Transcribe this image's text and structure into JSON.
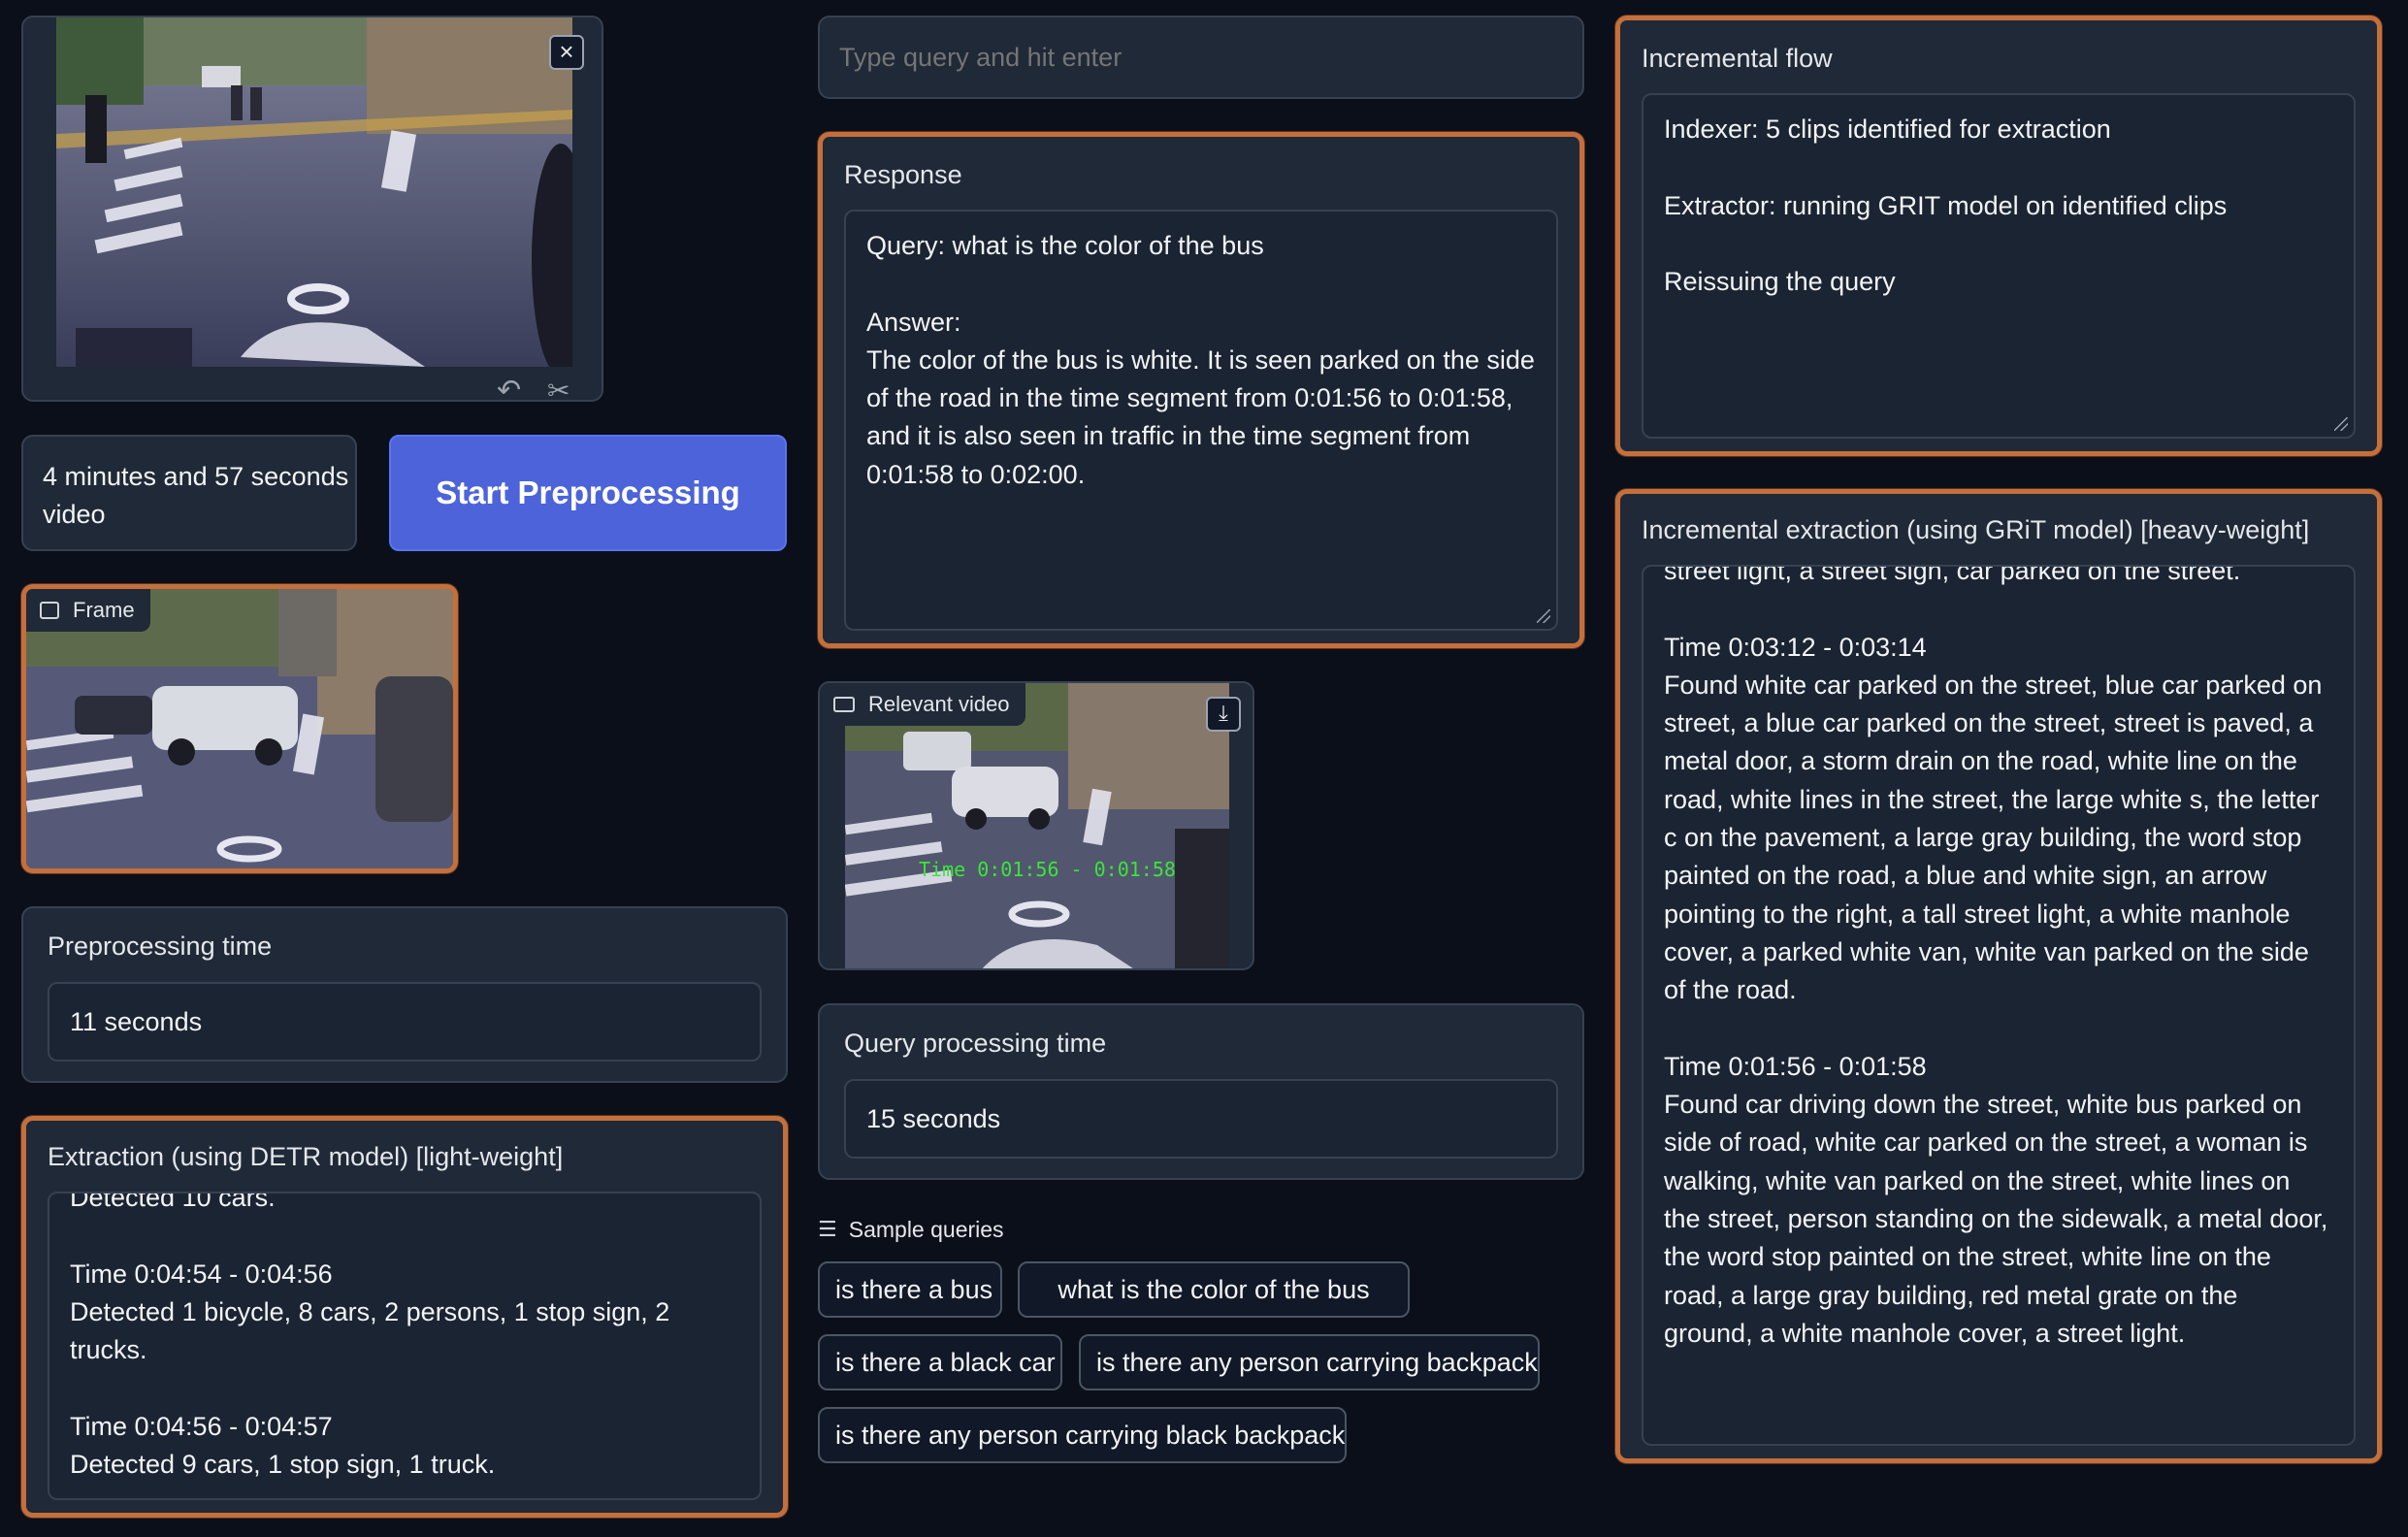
{
  "video_player": {
    "close_icon": "close-icon",
    "undo_icon": "undo-icon",
    "cut_icon": "scissors-icon"
  },
  "video_info": {
    "duration_text": "4 minutes and 57 seconds video"
  },
  "start_button": {
    "label": "Start Preprocessing",
    "color": "#4c63d9"
  },
  "frame": {
    "label": "Frame",
    "icon": "image-icon"
  },
  "preprocessing_time": {
    "label": "Preprocessing time",
    "value": "11 seconds"
  },
  "extraction": {
    "label": "Extraction (using DETR model) [light-weight]",
    "text": "Detected 10 cars.\n\nTime 0:04:54 - 0:04:56\nDetected 1 bicycle, 8 cars, 2 persons, 1 stop sign, 2 trucks.\n\nTime 0:04:56 - 0:04:57\nDetected 9 cars, 1 stop sign, 1 truck."
  },
  "query": {
    "placeholder": "Type query and hit enter"
  },
  "response": {
    "label": "Response",
    "text": "Query: what is the color of the bus\n\nAnswer:\nThe color of the bus is white. It is seen parked on the side of the road in the time segment from 0:01:56 to 0:01:58, and it is also seen in traffic in the time segment from 0:01:58 to 0:02:00."
  },
  "relevant_video": {
    "label": "Relevant video",
    "icon": "video-camera-icon",
    "download_icon": "download-icon",
    "overlay_text": "Time 0:01:56 - 0:01:58"
  },
  "query_processing_time": {
    "label": "Query processing time",
    "value": "15 seconds"
  },
  "sample_queries": {
    "label": "Sample queries",
    "icon": "list-icon",
    "items": [
      "is there a bus",
      "what is the color of the bus",
      "is there a black car",
      "is there any person carrying backpack",
      "is there any person carrying black backpack"
    ]
  },
  "incremental_flow": {
    "label": "Incremental flow",
    "text": "Indexer: 5 clips identified for extraction\n\nExtractor: running GRIT model on identified clips\n\nReissuing the query"
  },
  "incremental_extraction": {
    "label": "Incremental extraction (using GRiT model) [heavy-weight]",
    "text": "street light, a street sign, car parked on the street.\n\nTime 0:03:12 - 0:03:14\nFound white car parked on the street, blue car parked on street, a blue car parked on the street, street is paved, a metal door, a storm drain on the road, white line on the road, white lines in the street, the large white s, the letter c on the pavement, a large gray building, the word stop painted on the road, a blue and white sign, an arrow pointing to the right, a tall street light, a white manhole cover, a parked white van, white van parked on the side of the road.\n\nTime 0:01:56 - 0:01:58\nFound car driving down the street, white bus parked on side of road, white car parked on the street, a woman is walking, white van parked on the street, white lines on the street, person standing on the sidewalk, a metal door, the word stop painted on the street, white line on the road, a large gray building, red metal grate on the ground, a white manhole cover, a street light."
  }
}
